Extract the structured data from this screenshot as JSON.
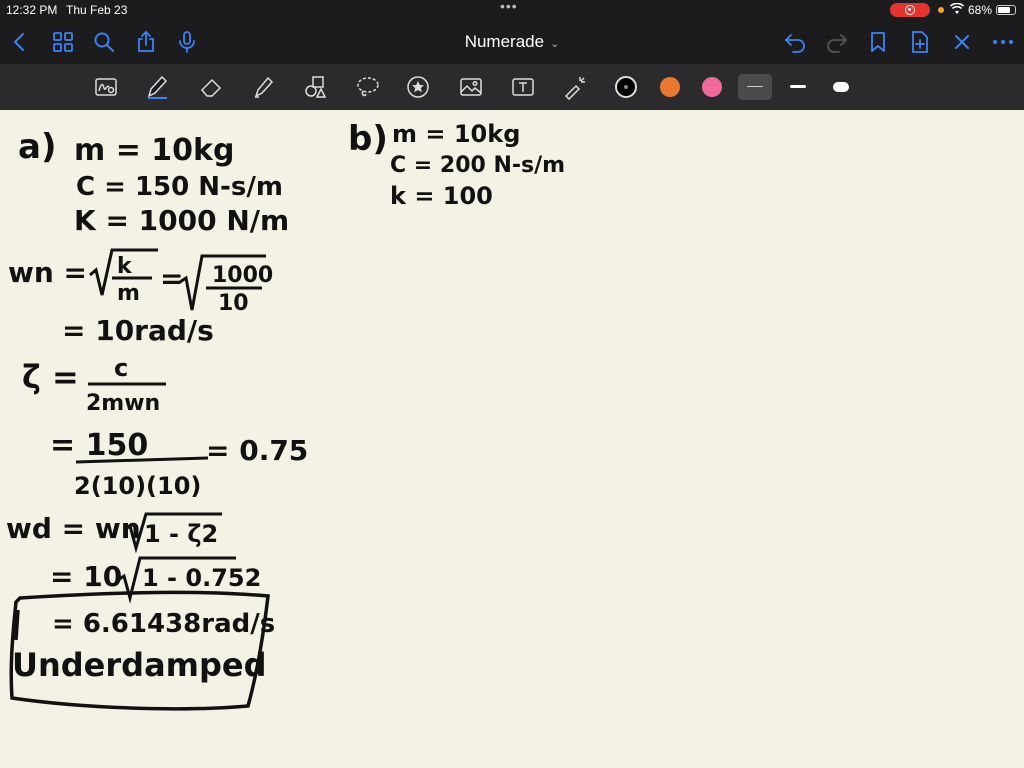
{
  "status_bar": {
    "time": "12:32 PM",
    "date": "Thu Feb 23",
    "battery_percent": "68%"
  },
  "nav": {
    "title": "Numerade",
    "icons": [
      "back-icon",
      "grid-icon",
      "search-icon",
      "share-icon",
      "microphone-icon",
      "undo-icon",
      "redo-icon",
      "bookmark-icon",
      "add-page-icon",
      "close-icon",
      "more-icon"
    ]
  },
  "toolbar": {
    "tools": [
      "handwriting-search-icon",
      "pen-icon",
      "eraser-icon",
      "highlighter-icon",
      "shapes-icon",
      "lasso-icon",
      "sticker-icon",
      "image-icon",
      "text-icon",
      "laser-pointer-icon"
    ],
    "colors": [
      "#000000",
      "#e8792e",
      "#f06b9c"
    ],
    "selected_width": "thin"
  },
  "notes": {
    "part_a": {
      "label": "a)",
      "m": "m = 10kg",
      "c": "C = 150 N-s/m",
      "k": "K = 1000 N/m",
      "wn_lhs": "wn =",
      "wn_frac1_num": "k",
      "wn_frac1_den": "m",
      "wn_eq": "=",
      "wn_frac2_num": "1000",
      "wn_frac2_den": "10",
      "wn_result": "= 10rad/s",
      "zeta_lhs": "ζ =",
      "zeta_num": "c",
      "zeta_den": "2mwn",
      "zeta_step_num": "= 150",
      "zeta_step_den": "2(10)(10)",
      "zeta_result": "= 0.75",
      "wd_lhs": "wd = wn",
      "wd_rad": "1 - ζ2",
      "wd_step_pre": "= 10",
      "wd_step_rad": "1 - 0.752",
      "wd_result": "= 6.61438rad/s",
      "conclusion": "Underdamped"
    },
    "part_b": {
      "label": "b)",
      "m": "m = 10kg",
      "c": "C = 200 N-s/m",
      "k": "k = 100"
    }
  }
}
